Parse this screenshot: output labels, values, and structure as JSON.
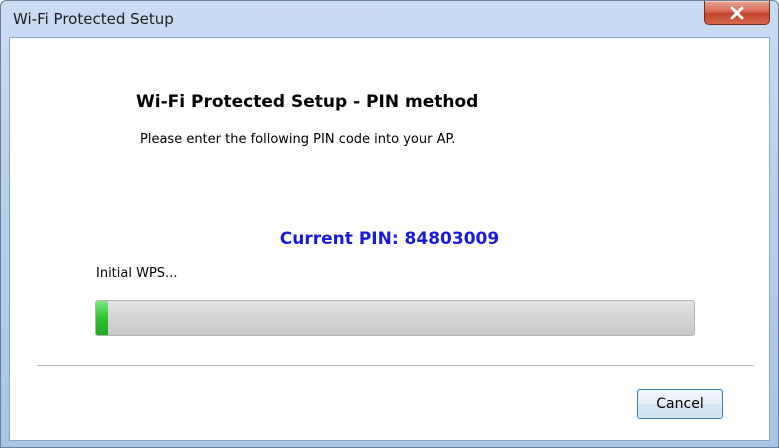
{
  "window": {
    "title": "Wi-Fi Protected Setup"
  },
  "content": {
    "heading": "Wi-Fi Protected Setup - PIN method",
    "instruction": "Please enter the following PIN code into your AP.",
    "pin_line": "Current PIN: 84803009",
    "status": "Initial WPS..."
  },
  "progress": {
    "value_percent": 2
  },
  "buttons": {
    "cancel_label": "Cancel"
  },
  "icons": {
    "close": "close-icon"
  },
  "colors": {
    "pin_text": "#1a1adc",
    "progress_fill": "#2fc32f",
    "close_button": "#c14329"
  }
}
